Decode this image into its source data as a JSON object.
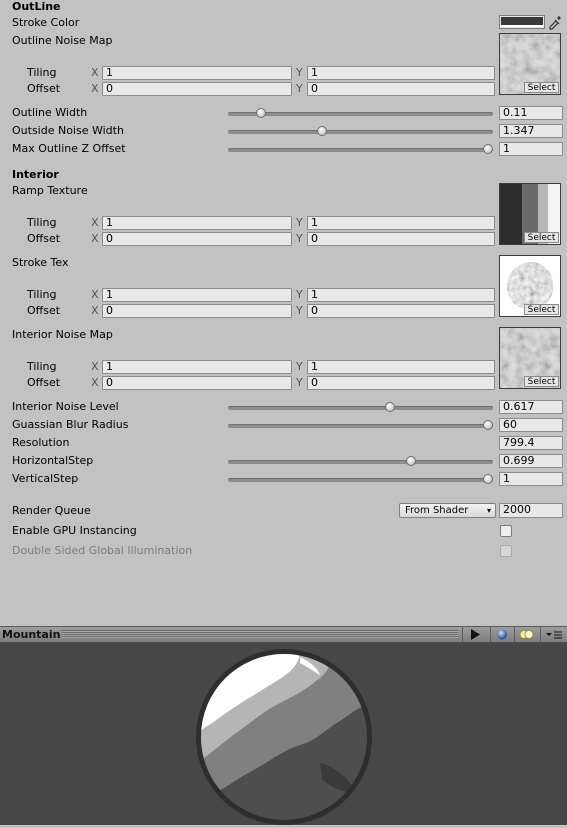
{
  "outline": {
    "header": "OutLine",
    "stroke_color_label": "Stroke Color",
    "stroke_color": "#3a3a3a",
    "noise_map_label": "Outline Noise Map",
    "noise_tiling": {
      "label": "Tiling",
      "x_axis": "X",
      "x": "1",
      "y_axis": "Y",
      "y": "1"
    },
    "noise_offset": {
      "label": "Offset",
      "x_axis": "X",
      "x": "0",
      "y_axis": "Y",
      "y": "0"
    },
    "select_label": "Select",
    "width_label": "Outline Width",
    "width_value": "0.11",
    "width_fraction": 0.11,
    "outside_noise_label": "Outside Noise Width",
    "outside_noise_value": "1.347",
    "outside_noise_fraction": 0.35,
    "max_z_label": "Max Outline Z Offset",
    "max_z_value": "1",
    "max_z_fraction": 1.0
  },
  "interior": {
    "header": "Interior",
    "ramp_label": "Ramp Texture",
    "ramp_tiling": {
      "label": "Tiling",
      "x_axis": "X",
      "x": "1",
      "y_axis": "Y",
      "y": "1"
    },
    "ramp_offset": {
      "label": "Offset",
      "x_axis": "X",
      "x": "0",
      "y_axis": "Y",
      "y": "0"
    },
    "stroke_tex_label": "Stroke Tex",
    "stroke_tiling": {
      "label": "Tiling",
      "x_axis": "X",
      "x": "1",
      "y_axis": "Y",
      "y": "1"
    },
    "stroke_offset": {
      "label": "Offset",
      "x_axis": "X",
      "x": "0",
      "y_axis": "Y",
      "y": "0"
    },
    "noise_map_label": "Interior Noise Map",
    "noise_tiling": {
      "label": "Tiling",
      "x_axis": "X",
      "x": "1",
      "y_axis": "Y",
      "y": "1"
    },
    "noise_offset": {
      "label": "Offset",
      "x_axis": "X",
      "x": "0",
      "y_axis": "Y",
      "y": "0"
    },
    "select_label": "Select",
    "noise_level_label": "Interior Noise Level",
    "noise_level_value": "0.617",
    "noise_level_fraction": 0.617,
    "blur_label": "Guassian Blur Radius",
    "blur_value": "60",
    "blur_fraction": 1.0,
    "resolution_label": "Resolution",
    "resolution_value": "799.4",
    "hstep_label": "HorizontalStep",
    "hstep_value": "0.699",
    "hstep_fraction": 0.699,
    "vstep_label": "VerticalStep",
    "vstep_value": "1",
    "vstep_fraction": 1.0
  },
  "render": {
    "queue_label": "Render Queue",
    "queue_mode": "From Shader",
    "queue_value": "2000",
    "gpu_label": "Enable GPU Instancing",
    "gpu_checked": false,
    "dsgi_label": "Double Sided Global Illumination",
    "dsgi_checked": false
  },
  "preview": {
    "title": "Mountain",
    "play_icon": "play-icon",
    "sphere_icon": "sphere-icon",
    "light_icon": "lights-icon",
    "menu_icon": "menu-icon"
  }
}
